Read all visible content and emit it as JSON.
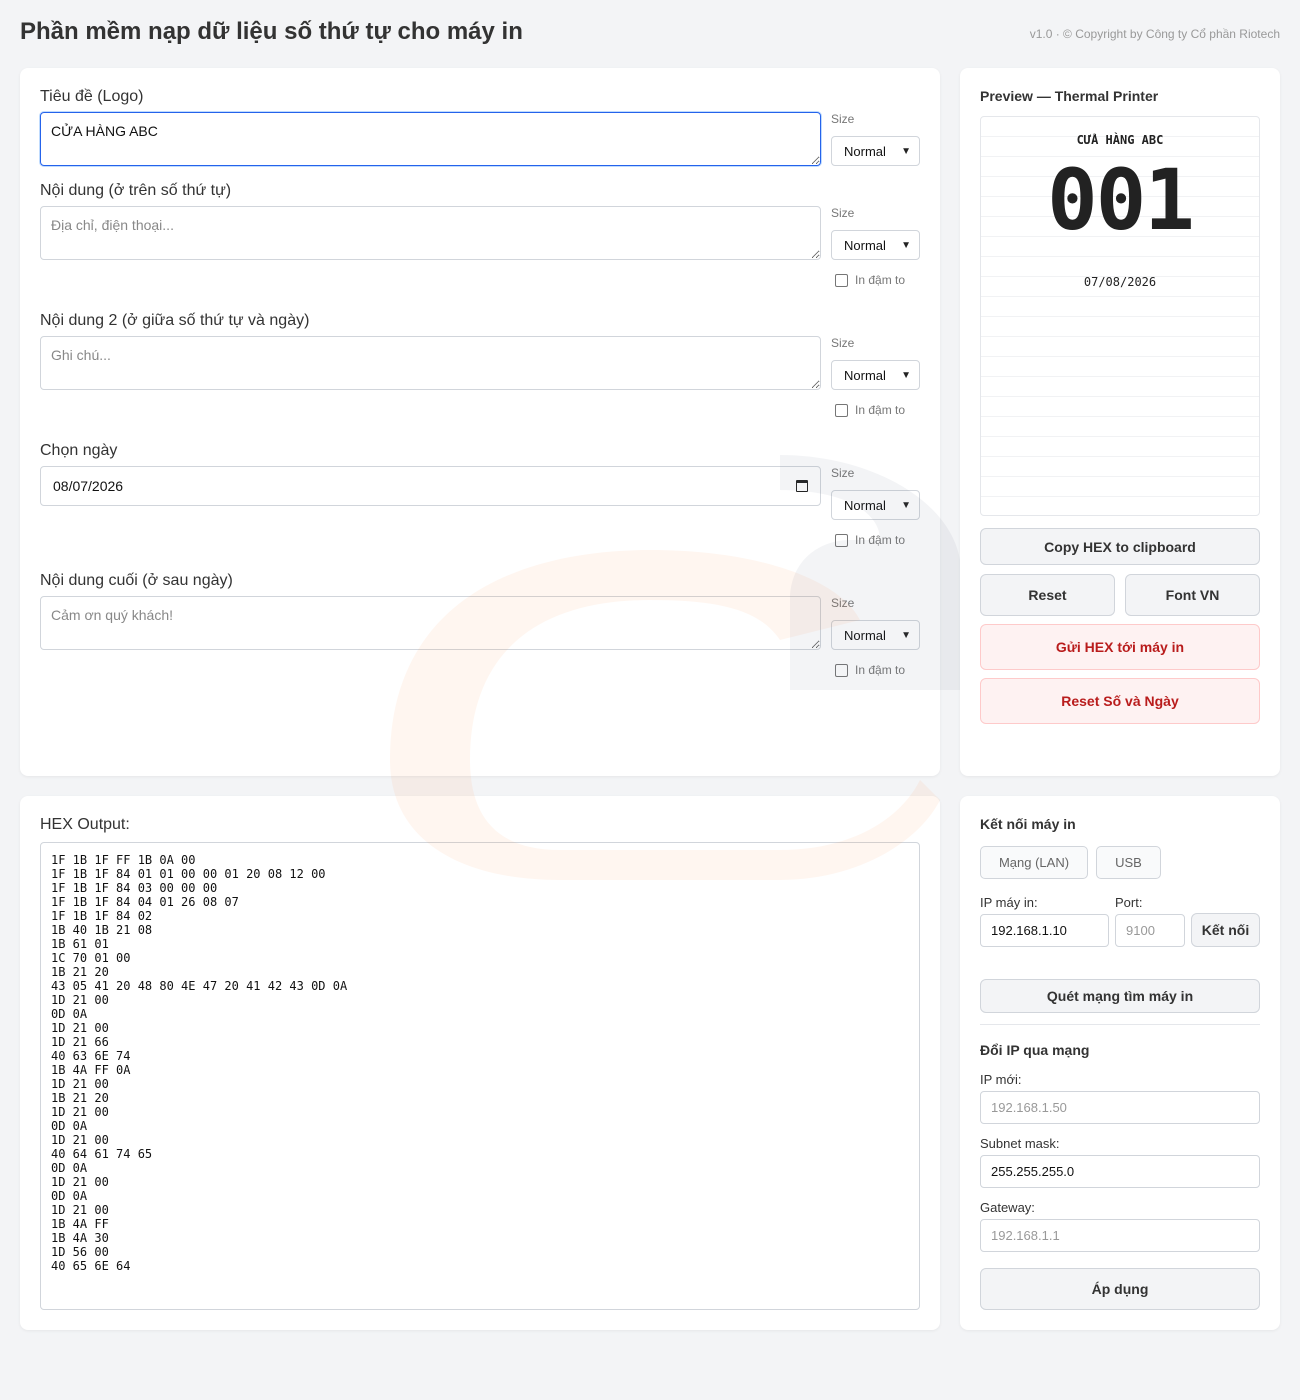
{
  "header": {
    "title": "Phần mềm nạp dữ liệu số thứ tự cho máy in",
    "copyright": "v1.0 · © Copyright by Công ty Cổ phần Riotech"
  },
  "form": {
    "size_label": "Size",
    "bold_label": "In đậm to",
    "size_option": "Normal",
    "logo": {
      "label": "Tiêu đề (Logo)",
      "value": "CỬA HÀNG ABC"
    },
    "content1": {
      "label": "Nội dung (ở trên số thứ tự)",
      "placeholder": "Địa chỉ, điện thoại..."
    },
    "content2": {
      "label": "Nội dung 2 (ở giữa số thứ tự và ngày)",
      "placeholder": "Ghi chú..."
    },
    "date": {
      "label": "Chọn ngày",
      "value": "08/07/2026"
    },
    "footer": {
      "label": "Nội dung cuối (ở sau ngày)",
      "placeholder": "Cảm ơn quý khách!"
    }
  },
  "preview": {
    "title": "Preview — Thermal Printer",
    "receipt_title": "CỬA HÀNG ABC",
    "receipt_number": "001",
    "receipt_date": "07/08/2026"
  },
  "actions": {
    "copy_hex": "Copy HEX to clipboard",
    "reset": "Reset",
    "font_vn": "Font VN",
    "send_hex": "Gửi HEX tới máy in",
    "reset_number_date": "Reset Số và Ngày"
  },
  "hex": {
    "label": "HEX Output:",
    "lines": [
      "1F 1B 1F FF 1B 0A 00",
      "1F 1B 1F 84 01 01 00 00 01 20 08 12 00",
      "1F 1B 1F 84 03 00 00 00",
      "1F 1B 1F 84 04 01 26 08 07",
      "1F 1B 1F 84 02",
      "1B 40 1B 21 08",
      "1B 61 01",
      "1C 70 01 00",
      "1B 21 20",
      "43 05 41 20 48 80 4E 47 20 41 42 43 0D 0A",
      "1D 21 00",
      "0D 0A",
      "1D 21 00",
      "1D 21 66",
      "40 63 6E 74",
      "1B 4A FF 0A",
      "1D 21 00",
      "1B 21 20",
      "1D 21 00",
      "0D 0A",
      "1D 21 00",
      "40 64 61 74 65",
      "0D 0A",
      "1D 21 00",
      "0D 0A",
      "1D 21 00",
      "1B 4A FF",
      "1B 4A 30",
      "1D 56 00",
      "40 65 6E 64"
    ]
  },
  "connection": {
    "title": "Kết nối máy in",
    "tab_lan": "Mạng (LAN)",
    "tab_usb": "USB",
    "ip_label": "IP máy in:",
    "ip_value": "192.168.1.10",
    "port_label": "Port:",
    "port_placeholder": "9100",
    "connect_button": "Kết nối",
    "scan_button": "Quét mạng tìm máy in",
    "change_ip_title": "Đổi IP qua mạng",
    "new_ip_label": "IP mới:",
    "new_ip_placeholder": "192.168.1.50",
    "subnet_label": "Subnet mask:",
    "subnet_value": "255.255.255.0",
    "gateway_label": "Gateway:",
    "gateway_placeholder": "192.168.1.1",
    "apply_button": "Áp dụng"
  }
}
